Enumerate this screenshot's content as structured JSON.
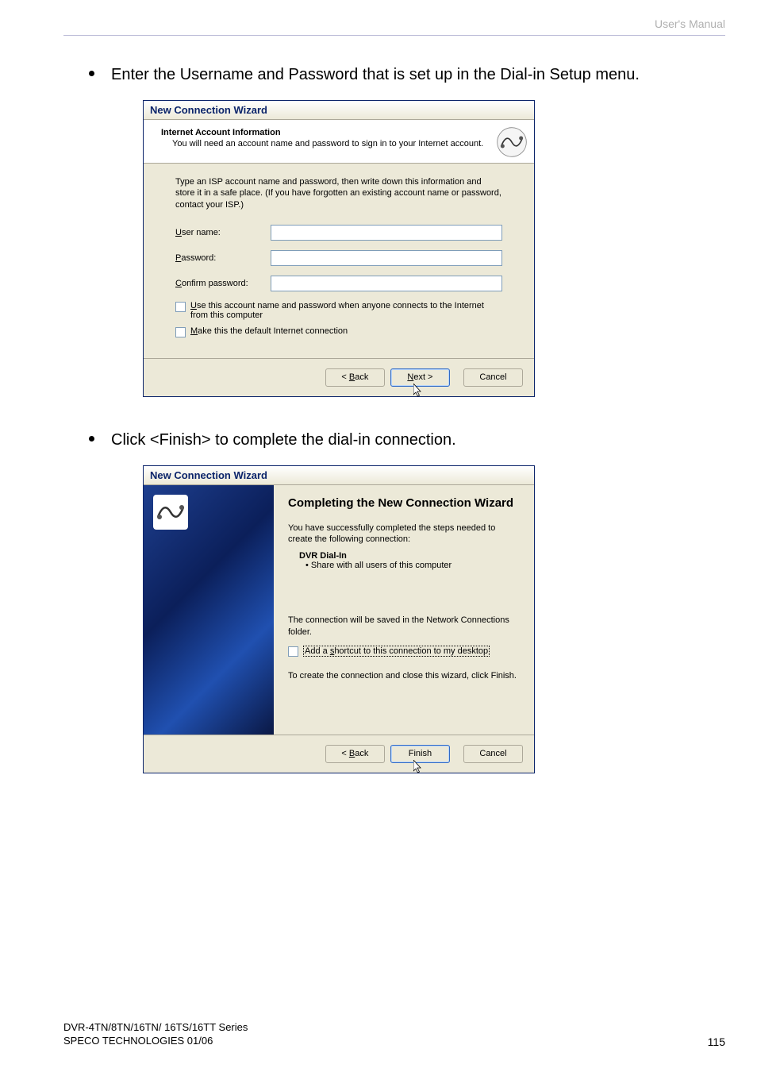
{
  "page": {
    "header": "User's Manual",
    "bullet1": "Enter the Username and Password that is set up in the Dial-in Setup menu.",
    "bullet2": "Click <Finish> to complete the dial-in connection.",
    "footer_line1": "DVR-4TN/8TN/16TN/ 16TS/16TT Series",
    "footer_line2": "SPECO TECHNOLOGIES 01/06",
    "page_number": "115"
  },
  "wizard1": {
    "title": "New Connection Wizard",
    "header_title": "Internet Account Information",
    "header_sub": "You will need an account name and password to sign in to your Internet account.",
    "instruction": "Type an ISP account name and password, then write down this information and store it in a safe place. (If you have forgotten an existing account name or password, contact your ISP.)",
    "label_username": "User name:",
    "label_password": "Password:",
    "label_confirm": "Confirm password:",
    "cb1": "Use this account name and password when anyone connects to the Internet from this computer",
    "cb2": "Make this the default Internet connection",
    "btn_back": "< Back",
    "btn_next": "Next >",
    "btn_cancel": "Cancel"
  },
  "wizard2": {
    "title": "New Connection Wizard",
    "heading": "Completing the New Connection Wizard",
    "sub1": "You have successfully completed the steps needed to create the following connection:",
    "conn_name": "DVR Dial-In",
    "share_line": "•   Share with all users of this computer",
    "saved": "The connection will be saved in the Network Connections folder.",
    "cb_shortcut": "Add a shortcut to this connection to my desktop",
    "close_instr": "To create the connection and close this wizard, click Finish.",
    "btn_back": "< Back",
    "btn_finish": "Finish",
    "btn_cancel": "Cancel"
  }
}
